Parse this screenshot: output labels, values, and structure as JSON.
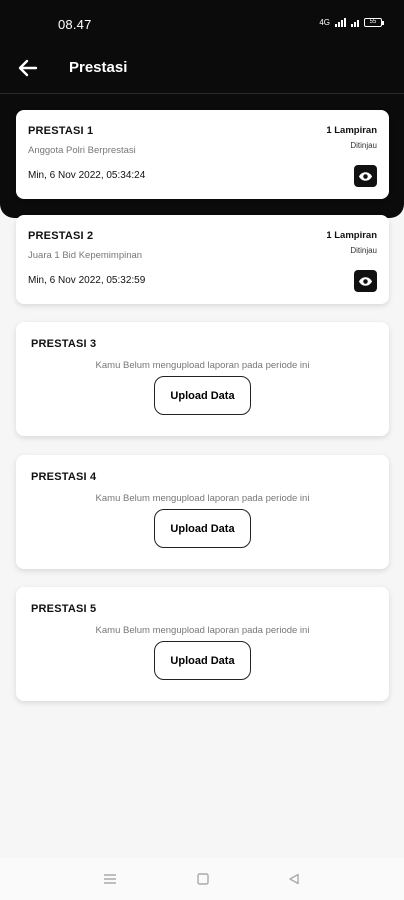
{
  "status_bar": {
    "time": "08.47",
    "network": "4G",
    "battery": "55"
  },
  "app_bar": {
    "title": "Prestasi",
    "back_icon": "arrow-left-icon"
  },
  "achievements": [
    {
      "title": "PRESTASI 1",
      "subtitle": "Anggota Polri Berprestasi",
      "date": "Min, 6 Nov 2022, 05:34:24",
      "attachment": "1 Lampiran",
      "status": "Ditinjau",
      "view_icon": "eye-icon"
    },
    {
      "title": "PRESTASI 2",
      "subtitle": "Juara 1 Bid Kepemimpinan",
      "date": "Min, 6 Nov 2022, 05:32:59",
      "attachment": "1 Lampiran",
      "status": "Ditinjau",
      "view_icon": "eye-icon"
    }
  ],
  "empty_slots": [
    {
      "title": "PRESTASI 3",
      "message": "Kamu Belum mengupload laporan pada periode ini",
      "button": "Upload Data"
    },
    {
      "title": "PRESTASI 4",
      "message": "Kamu Belum mengupload laporan pada periode ini",
      "button": "Upload Data"
    },
    {
      "title": "PRESTASI 5",
      "message": "Kamu Belum mengupload laporan pada periode ini",
      "button": "Upload Data"
    }
  ],
  "system_nav": {
    "icons": [
      "menu-icon",
      "home-square-icon",
      "back-triangle-icon"
    ]
  },
  "colors": {
    "header": "#0b0b0b",
    "background": "#f6f6f6",
    "card": "#ffffff",
    "accent": "#111111"
  }
}
